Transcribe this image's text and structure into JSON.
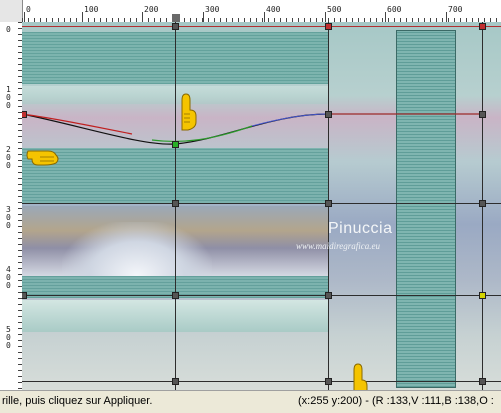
{
  "ruler_top": {
    "labels": [
      "0",
      "100",
      "200",
      "300",
      "400",
      "500",
      "600",
      "700"
    ]
  },
  "ruler_left": {
    "labels": [
      "0",
      "1\n0\n0",
      "2\n0\n0",
      "3\n0\n0",
      "4\n0\n0",
      "5\n0\n0"
    ]
  },
  "watermark": {
    "title": "Pinuccia",
    "url": "www.maidiregrafica.eu"
  },
  "status": {
    "hint": "rille, puis cliquez sur Appliquer.",
    "readout": "(x:255 y:200) - (R :133,V :111,B :138,O :"
  },
  "cursor_icons": [
    "pointing-hand-icon",
    "pointing-hand-icon",
    "pointing-hand-icon"
  ],
  "colors": {
    "hand": "#f5c400",
    "grid_line": "#2d2d2d",
    "status_bg": "#ece9d8"
  }
}
